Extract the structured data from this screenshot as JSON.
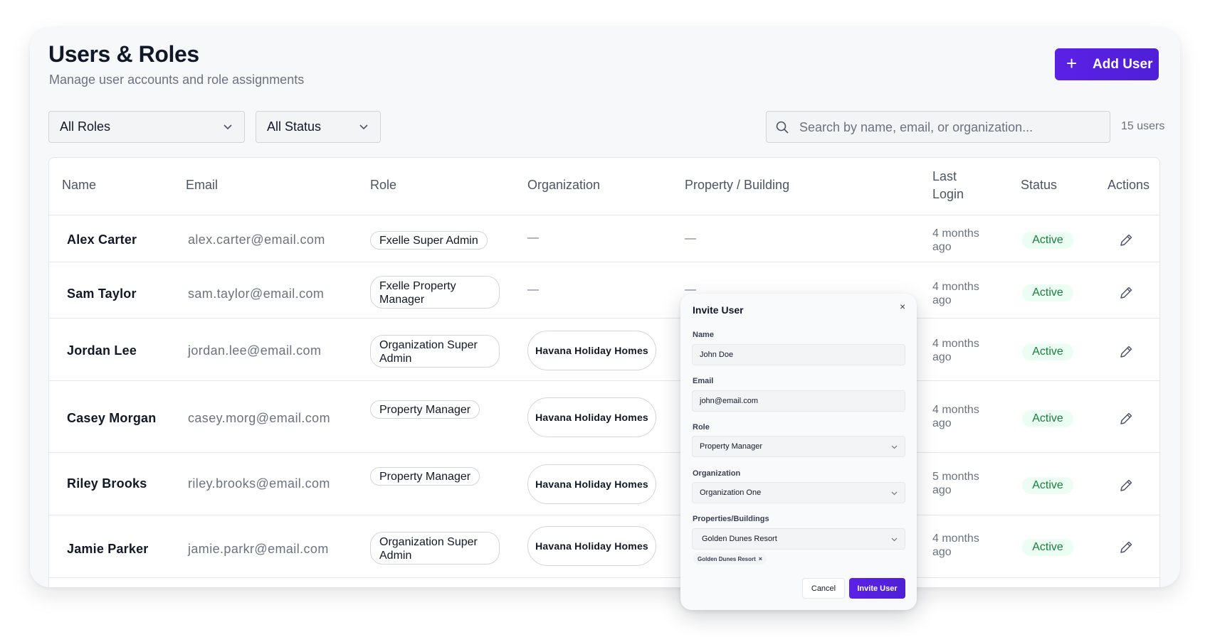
{
  "header": {
    "title": "Users & Roles",
    "subtitle": "Manage user accounts and role assignments",
    "add_user_label": "Add User"
  },
  "filters": {
    "roles_value": "All Roles",
    "status_value": "All Status",
    "search_placeholder": "Search by name, email, or organization...",
    "users_count": "15 users"
  },
  "table": {
    "columns": {
      "name": "Name",
      "email": "Email",
      "role": "Role",
      "organization": "Organization",
      "property": "Property / Building",
      "last_login": "Last Login",
      "status": "Status",
      "actions": "Actions"
    },
    "rows": [
      {
        "name": "Alex Carter",
        "email": "alex.carter@email.com",
        "role": "Fxelle Super Admin",
        "organization": "—",
        "property": "—",
        "last_login": "4 months ago",
        "status": "Active"
      },
      {
        "name": "Sam Taylor",
        "email": "sam.taylor@email.com",
        "role": "Fxelle Property Manager",
        "organization": "—",
        "property": "—",
        "last_login": "4 months ago",
        "status": "Active"
      },
      {
        "name": "Jordan Lee",
        "email": "jordan.lee@email.com",
        "role": "Organization Super Admin",
        "organization": "Havana Holiday Homes",
        "property": "",
        "last_login": "4 months ago",
        "status": "Active"
      },
      {
        "name": "Casey Morgan",
        "email": "casey.morg@email.com",
        "role": "Property Manager",
        "organization": "Havana Holiday Homes",
        "property": "",
        "last_login": "4 months ago",
        "status": "Active"
      },
      {
        "name": "Riley Brooks",
        "email": "riley.brooks@email.com",
        "role": "Property Manager",
        "organization": "Havana Holiday Homes",
        "property": "",
        "last_login": "5 months ago",
        "status": "Active"
      },
      {
        "name": "Jamie Parker",
        "email": "jamie.parkr@email.com",
        "role": "Organization Super Admin",
        "organization": "Havana Holiday Homes",
        "property": "",
        "last_login": "4 months ago",
        "status": "Active"
      }
    ]
  },
  "modal": {
    "title": "Invite User",
    "close_glyph": "×",
    "name_label": "Name",
    "name_value": "John Doe",
    "email_label": "Email",
    "email_value": "john@email.com",
    "role_label": "Role",
    "role_value": "Property Manager",
    "org_label": "Organization",
    "org_value": "Organization One",
    "properties_label": "Properties/Buildings",
    "properties_value": "Golden Dunes Resort",
    "chip_label": "Golden Dunes Resort",
    "chip_remove": "×",
    "cancel_label": "Cancel",
    "invite_label": "Invite User"
  },
  "colors": {
    "accent": "#5b21e6",
    "status_active_bg": "#ecfdf3",
    "status_active_text": "#15803d"
  }
}
